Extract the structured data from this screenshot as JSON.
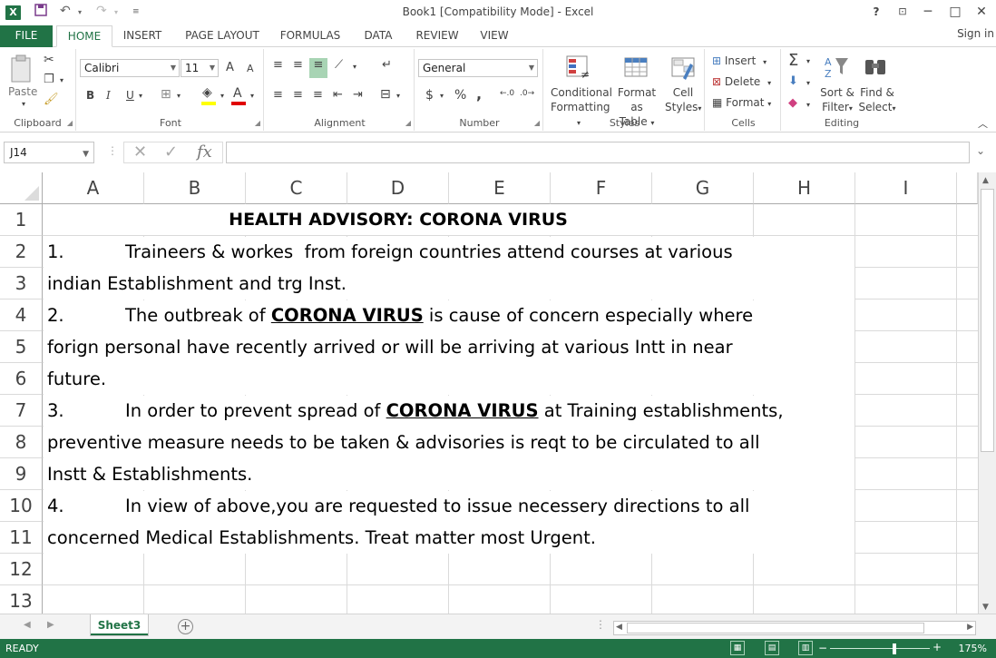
{
  "window": {
    "title": "Book1  [Compatibility Mode] - Excel",
    "help": "?",
    "minimize": "─",
    "maximize": "□",
    "close": "✕"
  },
  "tabs": [
    "FILE",
    "HOME",
    "INSERT",
    "PAGE LAYOUT",
    "FORMULAS",
    "DATA",
    "REVIEW",
    "VIEW"
  ],
  "active_tab": "HOME",
  "signin": "Sign in",
  "ribbon": {
    "clipboard": {
      "label": "Clipboard",
      "paste": "Paste"
    },
    "font": {
      "label": "Font",
      "name": "Calibri",
      "size": "11",
      "grow": "A",
      "shrink": "A",
      "bold": "B",
      "italic": "I",
      "underline": "U"
    },
    "alignment": {
      "label": "Alignment"
    },
    "number": {
      "label": "Number",
      "format": "General",
      "currency": "$",
      "percent": "%",
      "comma": ","
    },
    "styles": {
      "label": "Styles",
      "conditional": [
        "Conditional",
        "Formatting"
      ],
      "format_table": [
        "Format as",
        "Table"
      ],
      "cell_styles": [
        "Cell",
        "Styles"
      ]
    },
    "cells": {
      "label": "Cells",
      "insert": "Insert",
      "delete": "Delete",
      "format": "Format"
    },
    "editing": {
      "label": "Editing",
      "sort": [
        "Sort &",
        "Filter"
      ],
      "find": [
        "Find &",
        "Select"
      ]
    }
  },
  "formula_bar": {
    "name_box": "J14",
    "fx": "fx",
    "cancel": "✕",
    "enter": "✓",
    "value": ""
  },
  "columns": [
    "A",
    "B",
    "C",
    "D",
    "E",
    "F",
    "G",
    "H",
    "I"
  ],
  "rows": [
    "1",
    "2",
    "3",
    "4",
    "5",
    "6",
    "7",
    "8",
    "9",
    "10",
    "11",
    "12",
    "13"
  ],
  "sheet": {
    "title": "HEALTH ADVISORY: CORONA VIRUS",
    "r2_num": "1.",
    "r2_text": "Traineers & workes  from foreign countries attend courses at various",
    "r3": "indian Establishment and trg Inst.",
    "r4_num": "2.",
    "r4_pre": "The outbreak of ",
    "r4_bold": "CORONA VIRUS",
    "r4_post": " is cause of concern especially where",
    "r5": "forign personal have recently arrived or will be arriving at various Intt in near",
    "r6": "future.",
    "r7_num": "3.",
    "r7_pre": "In order to prevent spread of ",
    "r7_bold": "CORONA VIRUS",
    "r7_post": " at Training establishments,",
    "r8": "preventive measure needs to be taken & advisories is reqt to be circulated to all",
    "r9": "Instt & Establishments.",
    "r10_num": "4.",
    "r10_text": "In view of above,you are requested to issue necessery directions to all",
    "r11": "concerned Medical Establishments. Treat matter most Urgent."
  },
  "sheet_tab": "Sheet3",
  "add_sheet": "+",
  "status": {
    "ready": "READY",
    "zoom": "175%"
  },
  "colors": {
    "accent": "#217346"
  }
}
